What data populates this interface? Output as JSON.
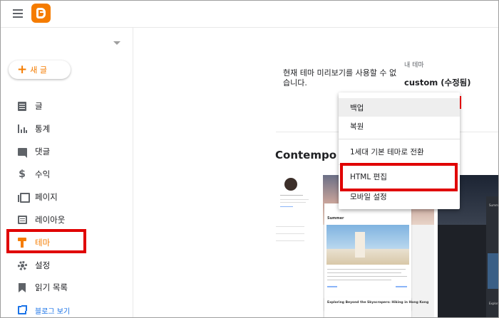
{
  "sidebar": {
    "new_post_label": "새 글",
    "items": [
      {
        "label": "글",
        "icon": "posts-icon"
      },
      {
        "label": "통계",
        "icon": "stats-icon"
      },
      {
        "label": "댓글",
        "icon": "comment-icon"
      },
      {
        "label": "수익",
        "icon": "dollar-icon"
      },
      {
        "label": "페이지",
        "icon": "pages-icon"
      },
      {
        "label": "레이아웃",
        "icon": "layout-icon"
      },
      {
        "label": "테마",
        "icon": "theme-icon"
      },
      {
        "label": "설정",
        "icon": "gear-icon"
      },
      {
        "label": "읽기 목록",
        "icon": "bookmark-icon"
      }
    ],
    "view_blog_label": "블로그 보기"
  },
  "main": {
    "preview_message": "현재 테마 미리보기를 사용할 수 없습니다.",
    "my_theme_label": "내 테마",
    "theme_name": "custom (수정됨)",
    "section_title": "Contempo"
  },
  "thumbnail": {
    "post_title_1": "Summer",
    "post_title_2": "Exploring Beyond the Skyscrapers: Hiking in Hong Kong",
    "dark_title": "Summ",
    "dark_title_2": "Explori"
  },
  "menu": {
    "items": [
      "백업",
      "복원",
      "1세대 기본 테마로 전환",
      "HTML 편집",
      "모바일 설정"
    ]
  },
  "colors": {
    "accent": "#f57c00",
    "highlight_box": "#e00000",
    "link": "#1a73e8"
  }
}
